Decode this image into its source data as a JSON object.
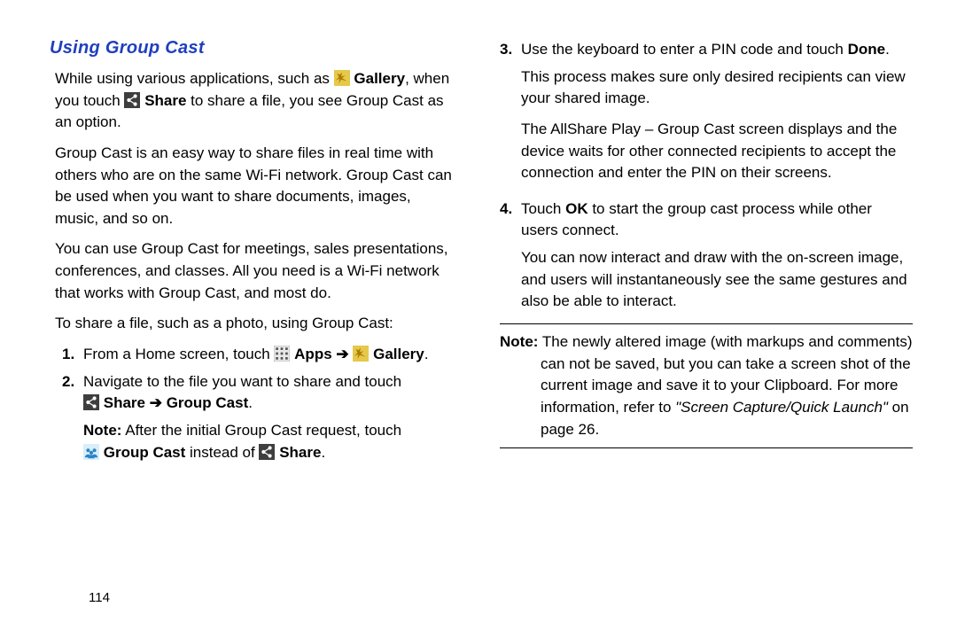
{
  "heading": "Using Group Cast",
  "left": {
    "p1": {
      "t1": "While using various applications, such as ",
      "gallery": "Gallery",
      "t2": ", when you touch ",
      "share": "Share",
      "t3": " to share a file, you see Group Cast as an option."
    },
    "p2": "Group Cast is an easy way to share files in real time with others who are on the same Wi-Fi network. Group Cast can be used when you want to share documents, images, music, and so on.",
    "p3": "You can use Group Cast for meetings, sales presentations, conferences, and classes. All you need is a Wi-Fi network that works with Group Cast, and most do.",
    "intro_steps": "To share a file, such as a photo, using Group Cast:",
    "step1": {
      "num": "1.",
      "t1": "From a Home screen, touch ",
      "apps": "Apps",
      "arrow": " ➔ ",
      "gallery": "Gallery",
      "period": "."
    },
    "step2": {
      "num": "2.",
      "t1": "Navigate to the file you want to share and touch ",
      "share": "Share",
      "arrow": " ➔ ",
      "gc": "Group Cast",
      "period": ".",
      "note_label": "Note:",
      "note_t1": " After the initial Group Cast request, touch ",
      "gc2": "Group Cast",
      "note_t2": " instead of ",
      "share2": "Share",
      "period2": "."
    }
  },
  "right": {
    "step3": {
      "num": "3.",
      "t1": "Use the keyboard to enter a PIN code and touch ",
      "done": "Done",
      "period": ".",
      "p2": "This process makes sure only desired recipients can view your shared image.",
      "p3": "The AllShare Play – Group Cast screen displays and the device waits for other connected recipients to accept the connection and enter the PIN on their screens."
    },
    "step4": {
      "num": "4.",
      "t1": "Touch ",
      "ok": "OK",
      "t2": " to start the group cast process while other users connect.",
      "p2": "You can now interact and draw with the on-screen image, and users will instantaneously see the same gestures and also be able to interact."
    },
    "note": {
      "label": "Note:",
      "t1": " The newly altered image (with markups and comments) can not be saved, but you can take a screen shot of the current image and save it to your Clipboard. For more information, refer to ",
      "xref": "\"Screen Capture/Quick Launch\"",
      "t2": " on page 26."
    }
  },
  "page_number": "114"
}
